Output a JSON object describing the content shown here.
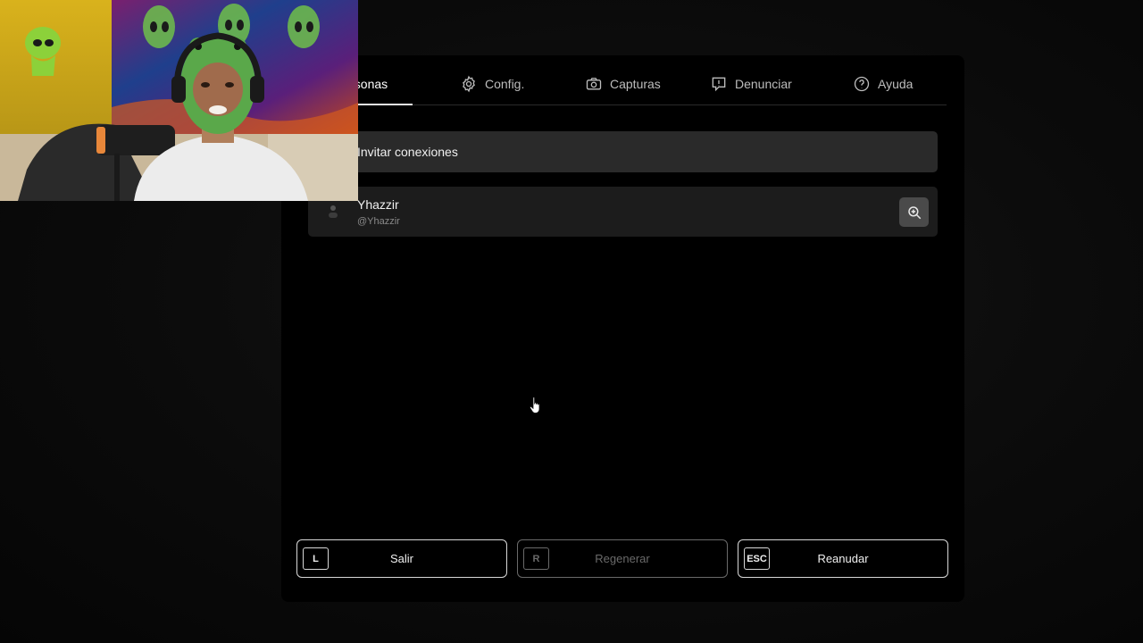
{
  "tabs": [
    {
      "label": "Personas",
      "icon": "people-icon",
      "active": true
    },
    {
      "label": "Config.",
      "icon": "gear-icon",
      "active": false
    },
    {
      "label": "Capturas",
      "icon": "camera-icon",
      "active": false
    },
    {
      "label": "Denunciar",
      "icon": "report-icon",
      "active": false
    },
    {
      "label": "Ayuda",
      "icon": "help-icon",
      "active": false
    }
  ],
  "invite": {
    "label": "Invitar conexiones"
  },
  "user": {
    "name": "Yhazzir",
    "handle": "@Yhazzir"
  },
  "actions": [
    {
      "key": "L",
      "label": "Salir",
      "enabled": true
    },
    {
      "key": "R",
      "label": "Regenerar",
      "enabled": false
    },
    {
      "key": "ESC",
      "label": "Reanudar",
      "enabled": true
    }
  ],
  "colors": {
    "panel": "#000000",
    "invite_bg": "#2a2a2a",
    "row_bg": "#1c1c1c",
    "border": "#d8d8d8",
    "disabled": "#6a6a6a"
  }
}
